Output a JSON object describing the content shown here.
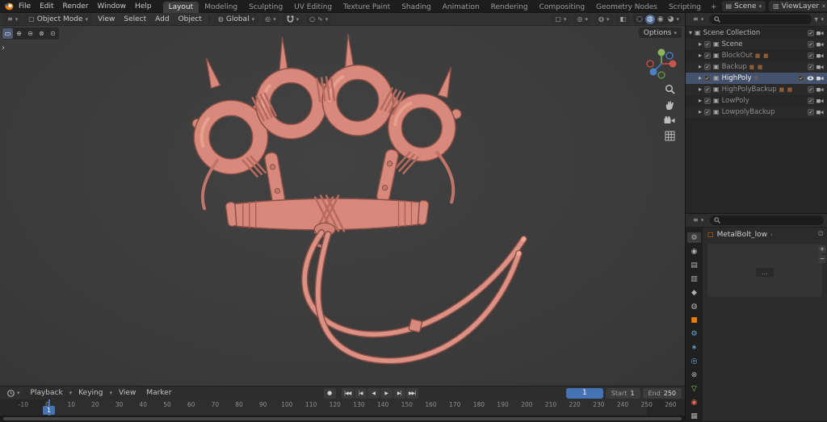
{
  "colors": {
    "accent_blue": "#4772b3",
    "accent_orange": "#e87d0d",
    "model_pink": "#d8897c"
  },
  "icons": {
    "chevron_down": "▾",
    "chevron_right": "▸",
    "expand_arrow": "›",
    "editor_menu": "≡",
    "collection": "▣",
    "scene_chip": "▤",
    "viewlayer_chip": "▥",
    "close": "✕",
    "object_mode": "▢",
    "globe": "◍",
    "pivot": "◎",
    "proportional": "○",
    "falloff": "∿",
    "snap": "#",
    "xray": "◧",
    "overlay": "◍",
    "wireframe": "○",
    "solid": "◍",
    "material": "◉",
    "rendered": "◕",
    "check": "✓",
    "record": "●",
    "pin": "⊙",
    "ellipsis": "…",
    "plus": "+",
    "minus": "−",
    "select_new": "▭",
    "select_extend": "⊕",
    "select_subtract": "⊖",
    "select_invert": "⊗",
    "select_intersect": "⊙"
  },
  "menubar": {
    "menus": [
      "File",
      "Edit",
      "Render",
      "Window",
      "Help"
    ],
    "tabs": [
      "Layout",
      "Modeling",
      "Sculpting",
      "UV Editing",
      "Texture Paint",
      "Shading",
      "Animation",
      "Rendering",
      "Compositing",
      "Geometry Nodes",
      "Scripting"
    ],
    "active_tab": "Layout",
    "add_tab": "+",
    "scene_label": "Scene",
    "viewlayer_label": "ViewLayer"
  },
  "vph": {
    "mode": "Object Mode",
    "menus": [
      "View",
      "Select",
      "Add",
      "Object"
    ],
    "orientation": "Global",
    "options": "Options"
  },
  "outliner": {
    "title": "Scene Collection",
    "items": [
      {
        "label": "Scene",
        "badge": ""
      },
      {
        "label": "BlockOut",
        "badge": "▦ ▦"
      },
      {
        "label": "Backup",
        "badge": "▦ ▦"
      },
      {
        "label": "HighPoly",
        "badge": "▽"
      },
      {
        "label": "HighPolyBackup",
        "badge": "▦ ▦"
      },
      {
        "label": "LowPoly",
        "badge": ""
      },
      {
        "label": "LowpolyBackup",
        "badge": ""
      }
    ]
  },
  "properties": {
    "tabs": [
      "⚙",
      "◉",
      "▤",
      "▥",
      "◆",
      "◍",
      "■",
      "⚙",
      "∗",
      "◎",
      "⊗",
      "▽",
      "◉",
      "▦"
    ],
    "breadcrumb": "MetalBolt_low",
    "crumb_arrow": "›"
  },
  "timeline": {
    "menus": [
      "Playback",
      "Keying",
      "View",
      "Marker"
    ],
    "transport": [
      "|◀◀",
      "|◀",
      "◀",
      "▶",
      "▶|",
      "▶▶|"
    ],
    "current_frame": "1",
    "start_label": "Start",
    "start_value": "1",
    "end_label": "End",
    "end_value": "250",
    "ticks": [
      "-10",
      "0",
      "10",
      "20",
      "30",
      "40",
      "50",
      "60",
      "70",
      "80",
      "90",
      "100",
      "110",
      "120",
      "130",
      "140",
      "150",
      "160",
      "170",
      "180",
      "190",
      "200",
      "210",
      "220",
      "230",
      "240",
      "250",
      "260"
    ]
  }
}
